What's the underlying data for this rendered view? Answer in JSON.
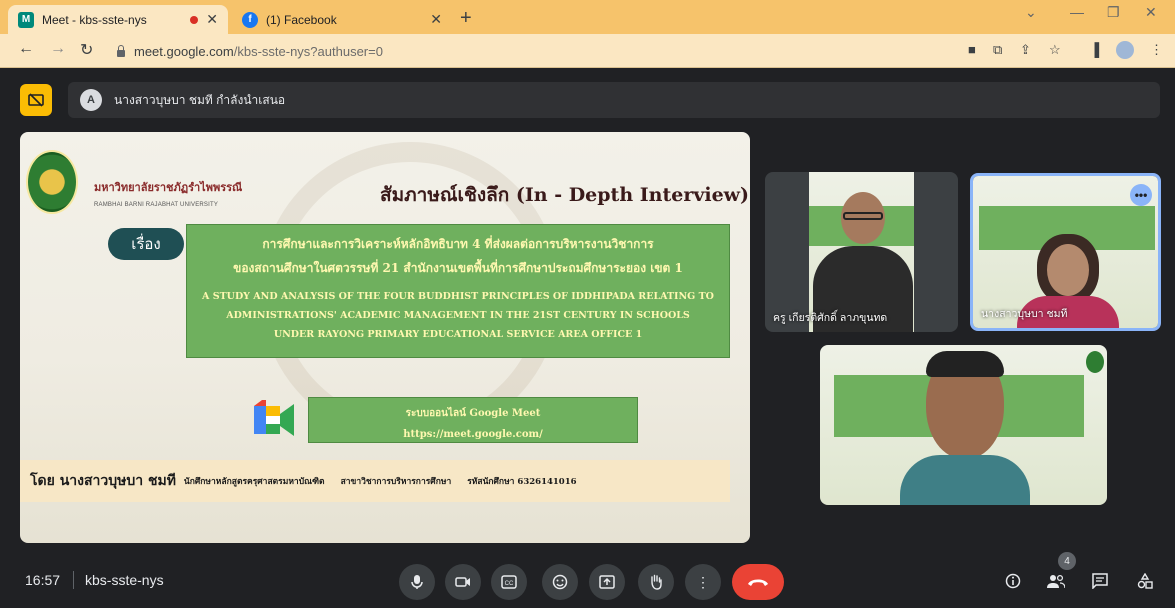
{
  "browser": {
    "tabs": [
      {
        "title": "Meet - kbs-sste-nys",
        "active": true,
        "recording": true
      },
      {
        "title": "(1) Facebook",
        "active": false
      }
    ],
    "new_tab_label": "+",
    "url_host": "meet.google.com",
    "url_path": "/kbs-sste-nys?authuser=0",
    "accent": "#f6c36b"
  },
  "meet": {
    "presenting_banner": "นางสาวบุษบา ชมที กำลังนำเสนอ",
    "presenter_initial": "A",
    "time": "16:57",
    "meeting_code": "kbs-sste-nys",
    "participant_count": "4"
  },
  "slide": {
    "university_th": "มหาวิทยาลัยราชภัฏรำไพพรรณี",
    "university_en": "RAMBHAI BARNI RAJABHAT UNIVERSITY",
    "title": "สัมภาษณ์เชิงลึก (In - Depth Interview)",
    "topic_label": "เรื่อง",
    "thai_title_line1": "การศึกษาและการวิเคราะห์หลักอิทธิบาท 4 ที่ส่งผลต่อการบริหารงานวิชาการ",
    "thai_title_line2": "ของสถานศึกษาในศตวรรษที่ 21 สำนักงานเขตพื้นที่การศึกษาประถมศึกษาระยอง เขต 1",
    "en_title_line1": "A STUDY AND ANALYSIS OF THE FOUR BUDDHIST PRINCIPLES OF IDDHIPADA RELATING TO",
    "en_title_line2": "ADMINISTRATIONS' ACADEMIC MANAGEMENT IN THE 21ST CENTURY IN SCHOOLS",
    "en_title_line3": "UNDER RAYONG PRIMARY EDUCATIONAL SERVICE AREA OFFICE 1",
    "online_system": "ระบบออนไลน์ Google Meet",
    "online_url": "https://meet.google.com/",
    "by_name": "โดย นางสาวบุษบา ชมที",
    "by_role": "นักศึกษาหลักสูตรครุศาสตรมหาบัณฑิต",
    "by_major": "สาขาวิชาการบริหารการศึกษา",
    "by_id": "รหัสนักศึกษา 6326141016"
  },
  "participants": [
    {
      "name": "ครู เกียรติศักดิ์ ลาภขุนทด"
    },
    {
      "name": "นางสาวบุษบา ชมที"
    },
    {
      "name": ""
    }
  ]
}
